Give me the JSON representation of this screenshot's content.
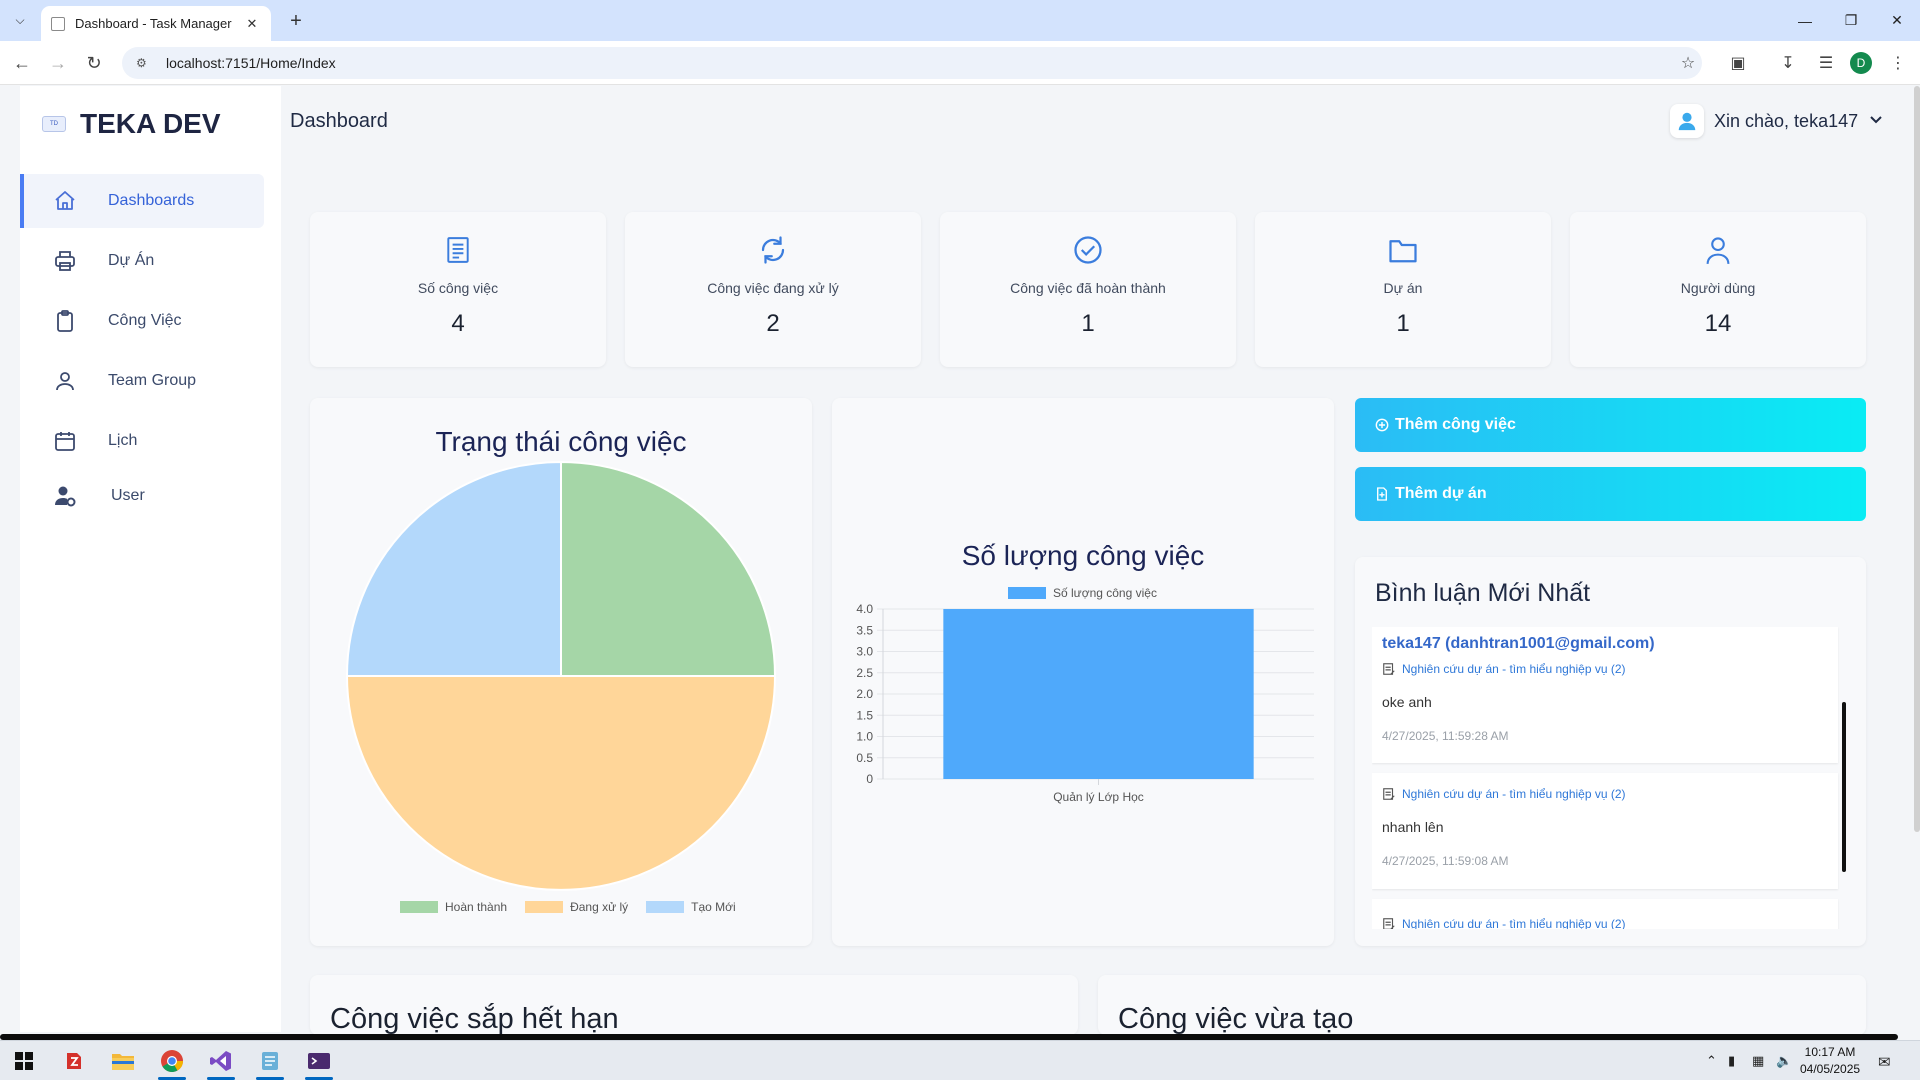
{
  "browser": {
    "tab_title": "Dashboard - Task Manager",
    "url": "localhost:7151/Home/Index",
    "profile_initial": "D"
  },
  "sidebar": {
    "brand": "TEKA DEV",
    "items": [
      {
        "label": "Dashboards",
        "icon": "home-icon",
        "active": true
      },
      {
        "label": "Dự Án",
        "icon": "printer-icon"
      },
      {
        "label": "Công Việc",
        "icon": "clipboard-icon"
      },
      {
        "label": "Team Group",
        "icon": "person-icon"
      },
      {
        "label": "Lịch",
        "icon": "calendar-icon"
      },
      {
        "label": "User",
        "icon": "user-gear-icon"
      }
    ]
  },
  "header": {
    "title": "Dashboard",
    "greeting": "Xin chào, teka147"
  },
  "stats": [
    {
      "label": "Số công việc",
      "value": "4",
      "icon": "document-icon"
    },
    {
      "label": "Công việc đang xử lý",
      "value": "2",
      "icon": "refresh-icon"
    },
    {
      "label": "Công việc đã hoàn thành",
      "value": "1",
      "icon": "check-circle-icon"
    },
    {
      "label": "Dự án",
      "value": "1",
      "icon": "folder-icon"
    },
    {
      "label": "Người dùng",
      "value": "14",
      "icon": "person-icon"
    }
  ],
  "chart_data": [
    {
      "type": "pie",
      "title": "Trạng thái công việc",
      "categories": [
        "Hoàn thành",
        "Đang xử lý",
        "Tạo Mới"
      ],
      "values": [
        1,
        2,
        1
      ],
      "colors": [
        "#a5d6a7",
        "#ffd699",
        "#b3d8fb"
      ]
    },
    {
      "type": "bar",
      "title": "Số lượng công việc",
      "categories": [
        "Quản lý Lớp Học"
      ],
      "series": [
        {
          "name": "Số lượng công việc",
          "values": [
            4
          ]
        }
      ],
      "ylim": [
        0,
        4
      ],
      "yticks": [
        "4.0",
        "3.5",
        "3.0",
        "2.5",
        "2.0",
        "1.5",
        "1.0",
        "0.5",
        "0"
      ],
      "color": "#4fa9fb",
      "legend": "top",
      "grid": true
    }
  ],
  "actions": {
    "add_task": "Thêm công việc",
    "add_project": "Thêm dự án"
  },
  "comments": {
    "title": "Bình luận Mới Nhất",
    "items": [
      {
        "author": "teka147 (danhtran1001@gmail.com)",
        "task": "Nghiên cứu dự án - tìm hiểu nghiệp vụ (2)",
        "text": "oke anh",
        "time": "4/27/2025, 11:59:28 AM"
      },
      {
        "task": "Nghiên cứu dự án - tìm hiểu nghiệp vụ (2)",
        "text": "nhanh lên",
        "time": "4/27/2025, 11:59:08 AM"
      },
      {
        "task": "Nghiên cứu dự án - tìm hiểu nghiệp vụ (2)"
      }
    ]
  },
  "sections": {
    "expiring": "Công việc sắp hết hạn",
    "recent": "Công việc vừa tạo"
  },
  "taskbar": {
    "time": "10:17 AM",
    "date": "04/05/2025"
  },
  "colors": {
    "accent": "#4a7cf3",
    "stat_icon": "#3b7ddd",
    "button_gradient_start": "#2bbcf5",
    "button_gradient_end": "#09ecf4"
  }
}
